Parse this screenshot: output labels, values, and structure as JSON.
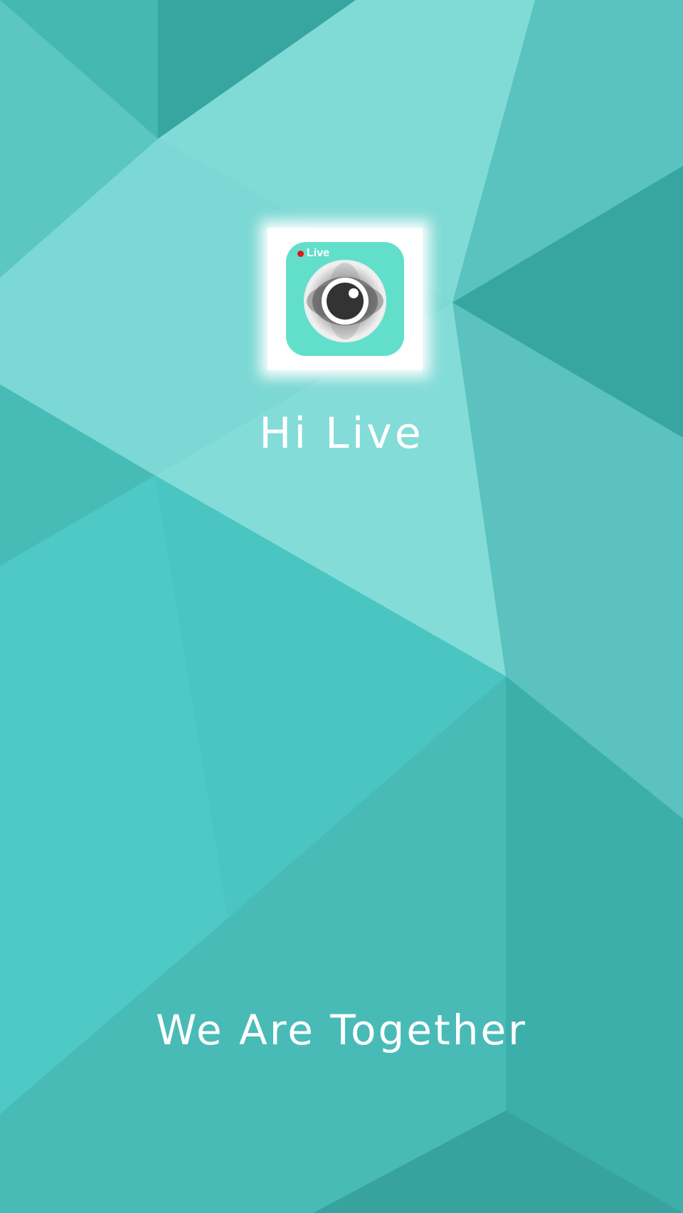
{
  "app": {
    "name": "Hi Live",
    "tagline": "We Are Together",
    "badge_label": "Live"
  },
  "icons": {
    "app_icon": "eye-lens-icon",
    "badge_dot": "record-dot-icon"
  },
  "colors": {
    "background_base": "#4fc6c2",
    "icon_background": "#62dfcb",
    "badge_dot": "#e11616",
    "text": "#ffffff"
  }
}
